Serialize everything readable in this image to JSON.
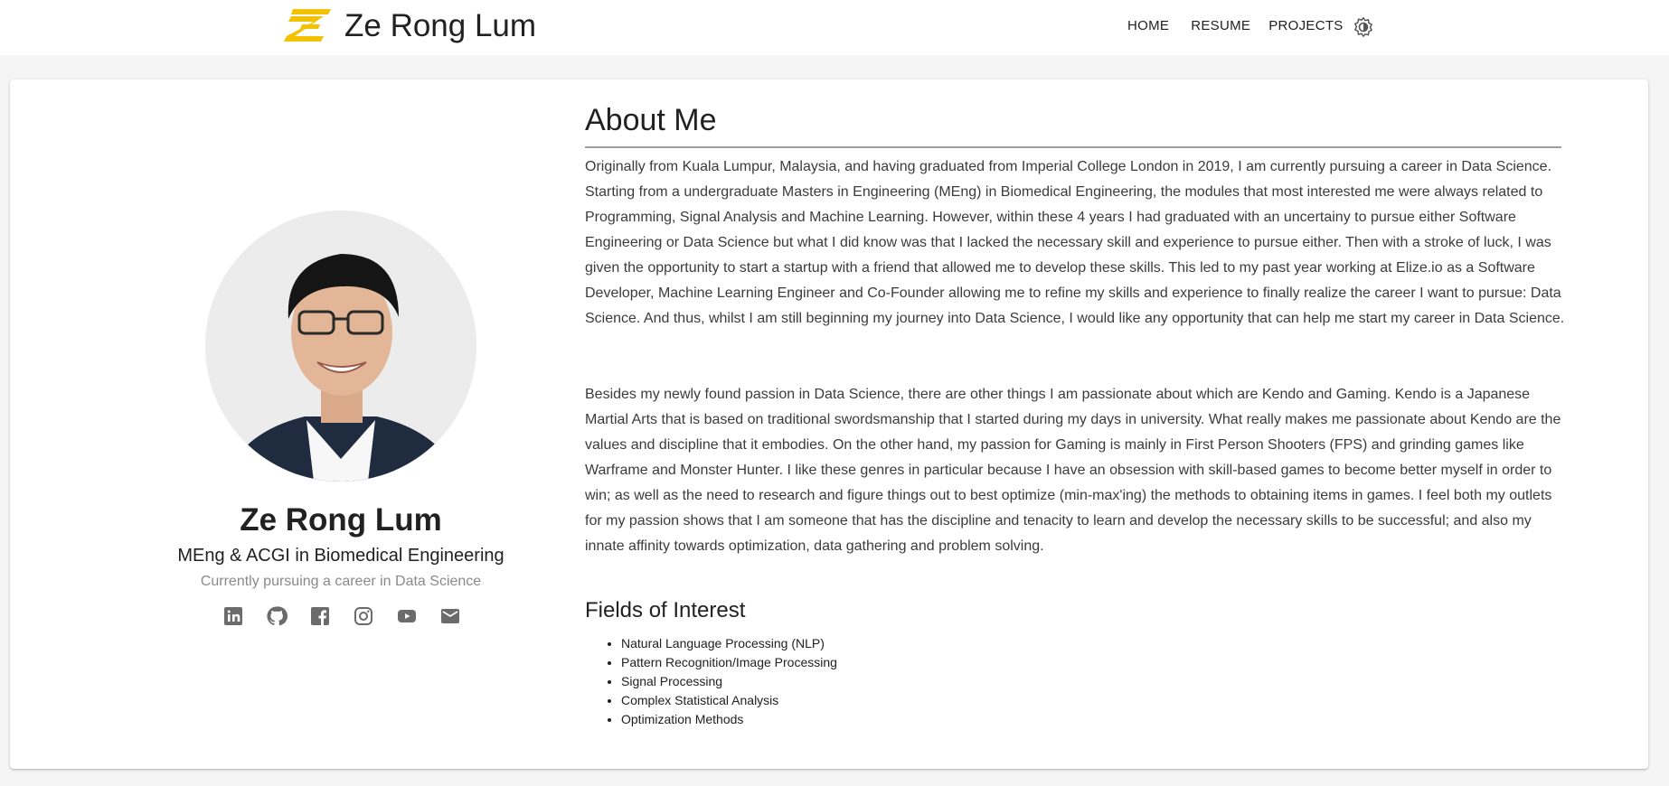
{
  "header": {
    "site_title": "Ze Rong Lum",
    "nav": [
      "HOME",
      "RESUME",
      "PROJECTS"
    ],
    "logo_color": "#f2c200"
  },
  "profile": {
    "name": "Ze Rong Lum",
    "degree": "MEng & ACGI in Biomedical Engineering",
    "tagline": "Currently pursuing a career in Data Science",
    "socials": [
      "linkedin-icon",
      "github-icon",
      "facebook-icon",
      "instagram-icon",
      "youtube-icon",
      "email-icon"
    ]
  },
  "about": {
    "title": "About Me",
    "paragraphs": [
      "Originally from Kuala Lumpur, Malaysia, and having graduated from Imperial College London in 2019, I am currently pursuing a career in Data Science. Starting from a undergraduate Masters in Engineering (MEng) in Biomedical Engineering, the modules that most interested me were always related to Programming, Signal Analysis and Machine Learning. However, within these 4 years I had graduated with an uncertainy to pursue either Software Engineering or Data Science but what I did know was that I lacked the necessary skill and experience to pursue either. Then with a stroke of luck, I was given the opportunity to start a startup with a friend that allowed me to develop these skills. This led to my past year working at Elize.io as a Software Developer, Machine Learning Engineer and Co-Founder allowing me to refine my skills and experience to finally realize the career I want to pursue: Data Science. And thus, whilst I am still beginning my journey into Data Science, I would like any opportunity that can help me start my career in Data Science.",
      "Besides my newly found passion in Data Science, there are other things I am passionate about which are Kendo and Gaming. Kendo is a Japanese Martial Arts that is based on traditional swordsmanship that I started during my days in university. What really makes me passionate about Kendo are the values and discipline that it embodies. On the other hand, my passion for Gaming is mainly in First Person Shooters (FPS) and grinding games like Warframe and Monster Hunter. I like these genres in particular because I have an obsession with skill-based games to become better myself in order to win; as well as the need to research and figure things out to best optimize (min-max'ing) the methods to obtaining items in games. I feel both my outlets for my passion shows that I am someone that has the discipline and tenacity to learn and develop the necessary skills to be successful; and also my innate affinity towards optimization, data gathering and problem solving."
    ]
  },
  "fields": {
    "title": "Fields of Interest",
    "items": [
      "Natural Language Processing (NLP)",
      "Pattern Recognition/Image Processing",
      "Signal Processing",
      "Complex Statistical Analysis",
      "Optimization Methods"
    ]
  }
}
